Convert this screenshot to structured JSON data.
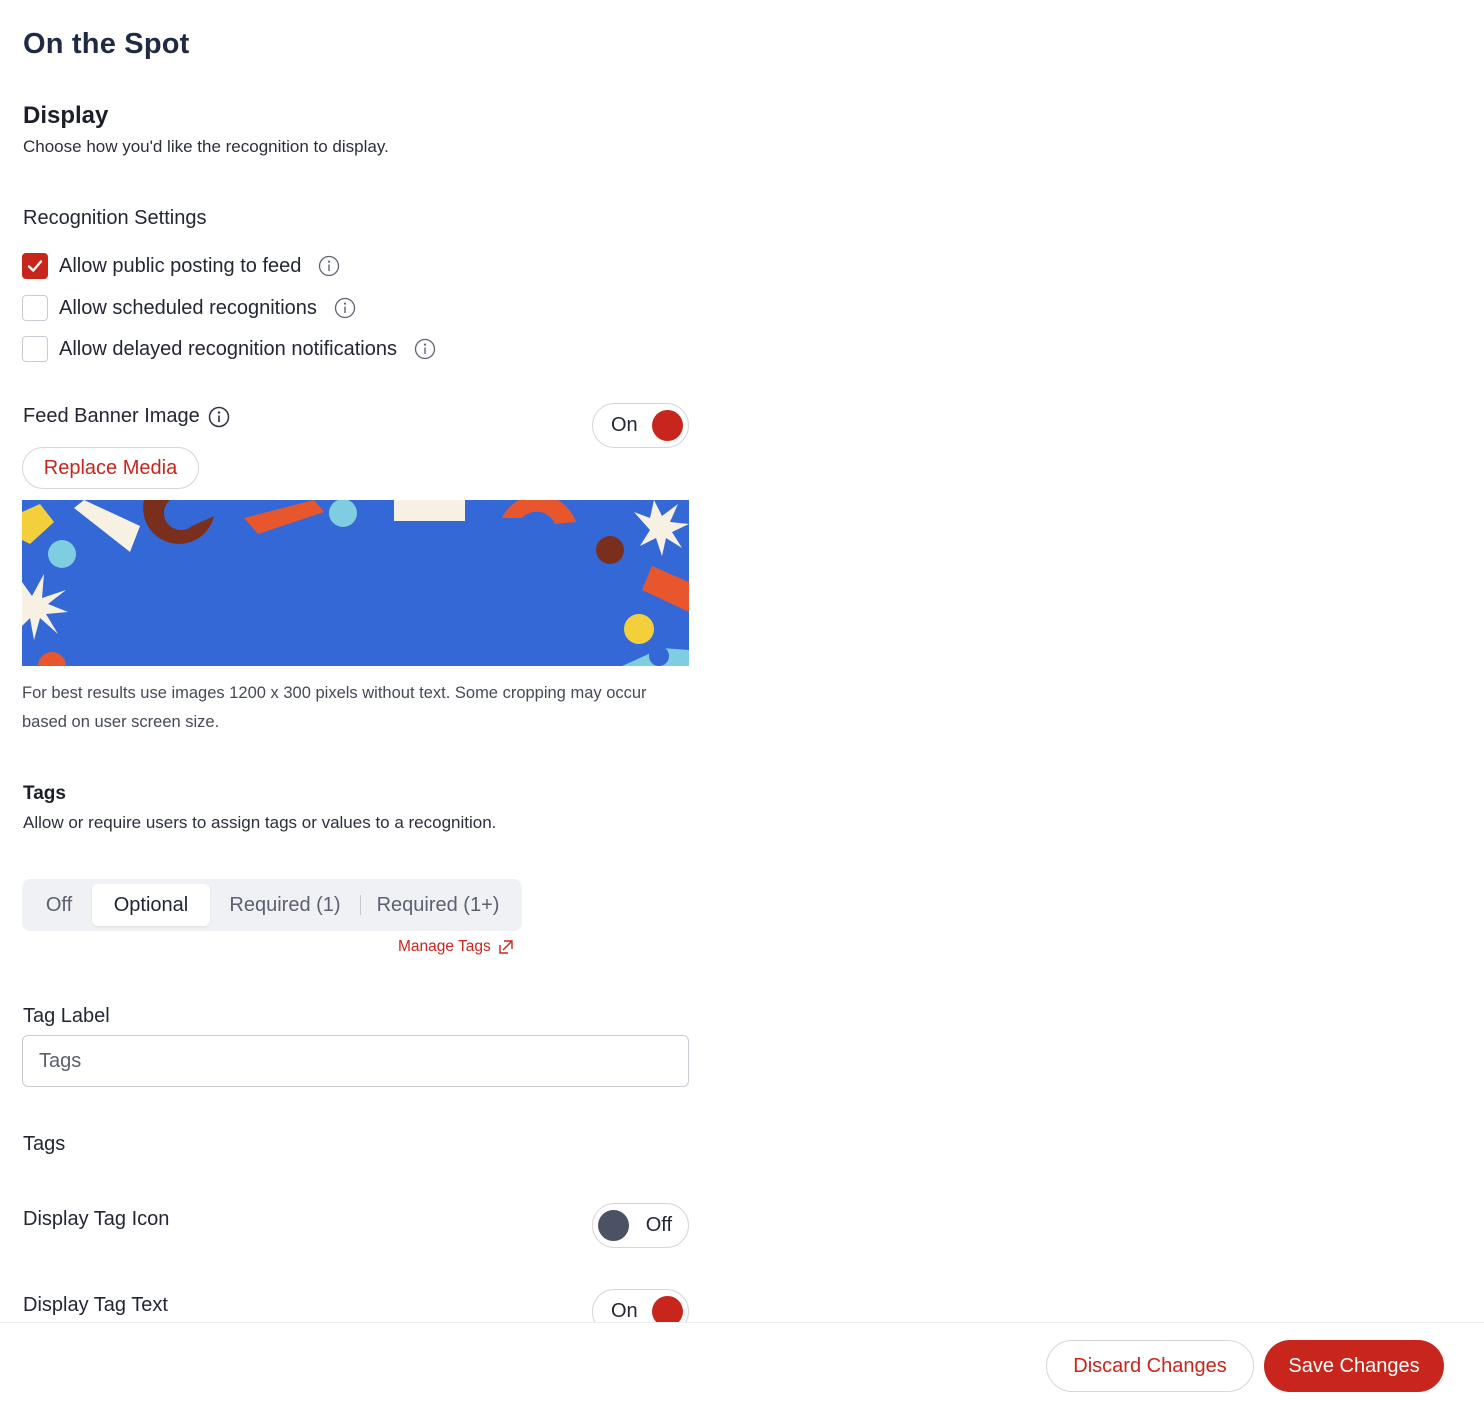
{
  "page": {
    "title": "On the Spot"
  },
  "display": {
    "title": "Display",
    "description": "Choose how you'd like the recognition to display."
  },
  "recognition_settings": {
    "label": "Recognition Settings",
    "options": [
      {
        "label": "Allow public posting to feed",
        "checked": true
      },
      {
        "label": "Allow scheduled recognitions",
        "checked": false
      },
      {
        "label": "Allow delayed recognition notifications",
        "checked": false
      }
    ]
  },
  "feed_banner": {
    "label": "Feed Banner Image",
    "toggle_label": "On",
    "replace_button": "Replace Media",
    "help_text": "For best results use images 1200 x 300 pixels without text. Some cropping may occur based on user screen size."
  },
  "tags": {
    "title": "Tags",
    "description": "Allow or require users to assign tags or values to a recognition.",
    "segments": [
      "Off",
      "Optional",
      "Required (1)",
      "Required (1+)"
    ],
    "selected_segment": "Optional",
    "manage_link": "Manage Tags",
    "tag_label_heading": "Tag Label",
    "tag_label_value": "Tags",
    "tags_heading": "Tags",
    "display_tag_icon": {
      "label": "Display Tag Icon",
      "toggle_label": "Off"
    },
    "display_tag_text": {
      "label": "Display Tag Text",
      "toggle_label": "On"
    }
  },
  "footer": {
    "discard_label": "Discard Changes",
    "save_label": "Save Changes"
  },
  "colors": {
    "accent": "#c8251d",
    "banner_blue": "#3468d6",
    "toggle_off_knob": "#4b5263"
  }
}
